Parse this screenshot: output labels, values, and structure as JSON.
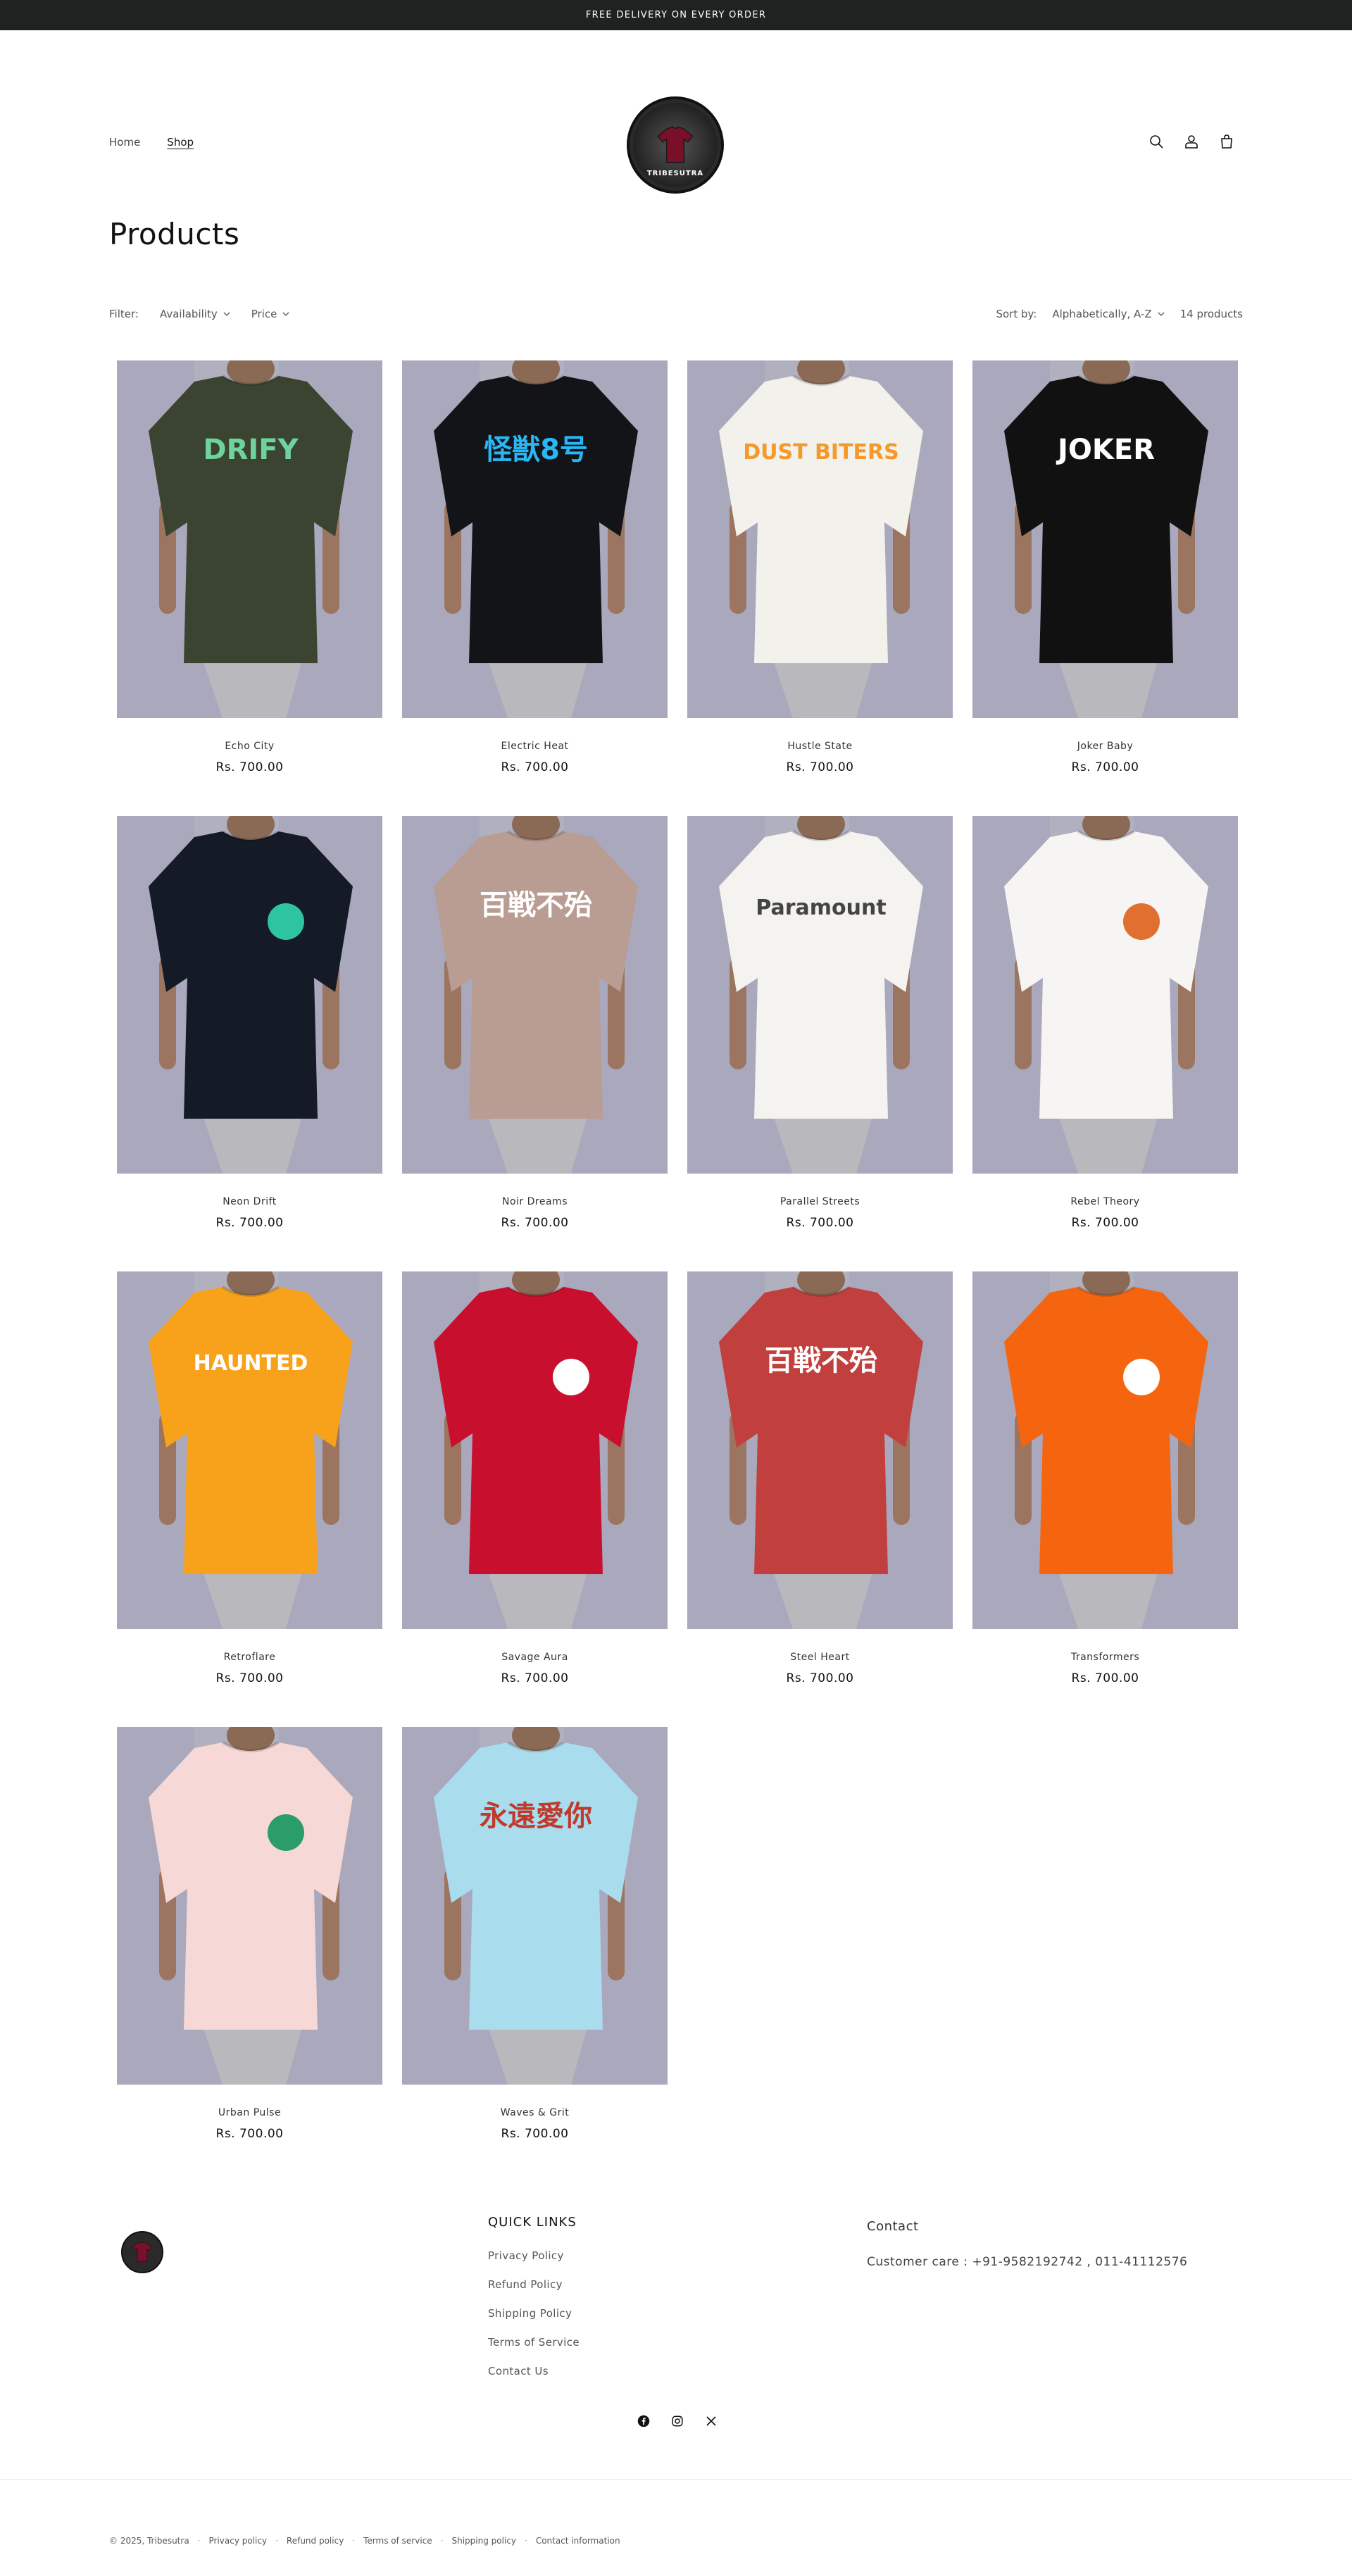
{
  "announcement": "FREE DELIVERY ON EVERY ORDER",
  "nav": [
    {
      "label": "Home"
    },
    {
      "label": "Shop"
    }
  ],
  "logo_text": "TRIBESUTRA",
  "page_title": "Products",
  "facets": {
    "filter_label": "Filter:",
    "availability_label": "Availability",
    "price_label": "Price",
    "sort_label": "Sort by:",
    "sort_value": "Alphabetically, A-Z",
    "count": "14 products"
  },
  "products": [
    {
      "name": "Echo City",
      "price": "Rs. 700.00",
      "shirt_color": "#3a4430",
      "print": "DRIFY",
      "print_color": "#6fd3a0"
    },
    {
      "name": "Electric Heat",
      "price": "Rs. 700.00",
      "shirt_color": "#121418",
      "print": "怪獣8号",
      "print_color": "#29b6f6"
    },
    {
      "name": "Hustle State",
      "price": "Rs. 700.00",
      "shirt_color": "#f2f1ec",
      "print": "DUST BITERS",
      "print_color": "#f59a2a"
    },
    {
      "name": "Joker Baby",
      "price": "Rs. 700.00",
      "shirt_color": "#111111",
      "print": "JOKER",
      "print_color": "#ffffff"
    },
    {
      "name": "Neon Drift",
      "price": "Rs. 700.00",
      "shirt_color": "#141a26",
      "print": "",
      "print_color": "#2ec4a0"
    },
    {
      "name": "Noir Dreams",
      "price": "Rs. 700.00",
      "shirt_color": "#b99c92",
      "print": "百戦不殆",
      "print_color": "#ffffff"
    },
    {
      "name": "Parallel Streets",
      "price": "Rs. 700.00",
      "shirt_color": "#f4f3ef",
      "print": "Paramount",
      "print_color": "#444444"
    },
    {
      "name": "Rebel Theory",
      "price": "Rs. 700.00",
      "shirt_color": "#f6f5f3",
      "print": "",
      "print_color": "#e07030"
    },
    {
      "name": "Retroflare",
      "price": "Rs. 700.00",
      "shirt_color": "#f7a21a",
      "print": "HAUNTED",
      "print_color": "#ffffff"
    },
    {
      "name": "Savage Aura",
      "price": "Rs. 700.00",
      "shirt_color": "#c8102e",
      "print": "",
      "print_color": "#ffffff"
    },
    {
      "name": "Steel Heart",
      "price": "Rs. 700.00",
      "shirt_color": "#c1403e",
      "print": "百戦不殆",
      "print_color": "#ffffff"
    },
    {
      "name": "Transformers",
      "price": "Rs. 700.00",
      "shirt_color": "#f5650f",
      "print": "",
      "print_color": "#ffffff"
    },
    {
      "name": "Urban Pulse",
      "price": "Rs. 700.00",
      "shirt_color": "#f6d9d6",
      "print": "",
      "print_color": "#2a9d6a"
    },
    {
      "name": "Waves & Grit",
      "price": "Rs. 700.00",
      "shirt_color": "#a9dcec",
      "print": "永遠愛你",
      "print_color": "#c0392b"
    }
  ],
  "footer": {
    "quick_links_heading": "QUICK LINKS",
    "quick_links": [
      "Privacy Policy",
      "Refund Policy",
      "Shipping Policy",
      "Terms of Service",
      "Contact Us"
    ],
    "contact_heading": "Contact",
    "contact_text": "Customer care : +91-9582192742 , 011-41112576",
    "social": [
      "facebook-icon",
      "instagram-icon",
      "x-icon"
    ],
    "copyright": "© 2025, Tribesutra",
    "legal_links": [
      "Privacy policy",
      "Refund policy",
      "Terms of service",
      "Shipping policy",
      "Contact information"
    ]
  },
  "colors": {
    "announcement_bg": "#202222",
    "logo_shirt": "#7a0f2a",
    "photo_bg": "#a9a8bd"
  }
}
